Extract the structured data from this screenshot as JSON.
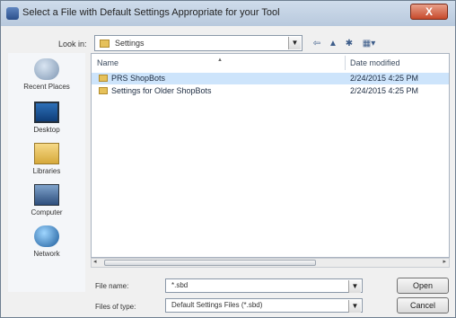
{
  "window": {
    "title": "Select a File with Default Settings Appropriate for your Tool",
    "close_label": "X"
  },
  "lookin": {
    "label": "Look in:",
    "value": "Settings"
  },
  "toolbar": {
    "back_label": "⇦",
    "up_label": "▲",
    "new_folder_label": "✱",
    "views_label": "▦▾"
  },
  "places": [
    {
      "label": "Recent Places",
      "icon": "recent-places-icon"
    },
    {
      "label": "Desktop",
      "icon": "desktop-icon"
    },
    {
      "label": "Libraries",
      "icon": "libraries-icon"
    },
    {
      "label": "Computer",
      "icon": "computer-icon"
    },
    {
      "label": "Network",
      "icon": "network-icon"
    }
  ],
  "filelist": {
    "columns": {
      "name": "Name",
      "date": "Date modified"
    },
    "rows": [
      {
        "name": "PRS ShopBots",
        "date": "2/24/2015 4:25 PM",
        "selected": true
      },
      {
        "name": "Settings for Older ShopBots",
        "date": "2/24/2015 4:25 PM",
        "selected": false
      }
    ]
  },
  "filename": {
    "label": "File name:",
    "value": "*.sbd"
  },
  "filetype": {
    "label": "Files of type:",
    "value": "Default Settings Files (*.sbd)"
  },
  "buttons": {
    "open": "Open",
    "cancel": "Cancel"
  }
}
